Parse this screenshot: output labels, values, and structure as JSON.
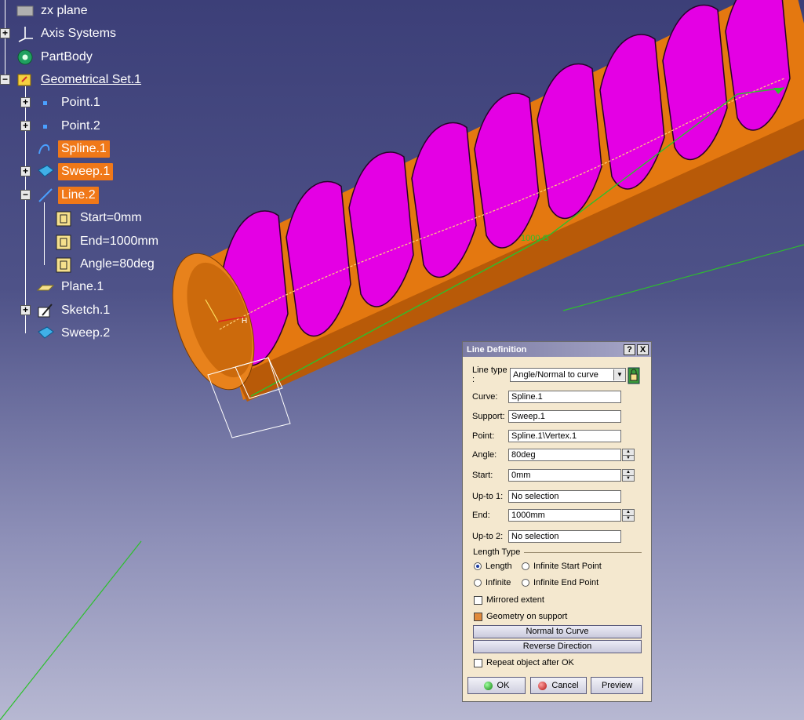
{
  "tree": {
    "zx_plane": "zx plane",
    "axis_systems": "Axis Systems",
    "partbody": "PartBody",
    "geometrical_set": "Geometrical Set.1",
    "point1": "Point.1",
    "point2": "Point.2",
    "spline1": "Spline.1",
    "sweep1": "Sweep.1",
    "line2": "Line.2",
    "start": "Start=0mm",
    "end": "End=1000mm",
    "angle": "Angle=80deg",
    "plane1": "Plane.1",
    "sketch1": "Sketch.1",
    "sweep2": "Sweep.2"
  },
  "viewport": {
    "dimension_label": "1000 G"
  },
  "dialog": {
    "title": "Line Definition",
    "help_button": "?",
    "close_button": "X",
    "line_type_label": "Line type :",
    "line_type_value": "Angle/Normal to curve",
    "curve_label": "Curve:",
    "curve_value": "Spline.1",
    "support_label": "Support:",
    "support_value": "Sweep.1",
    "point_label": "Point:",
    "point_value": "Spline.1\\Vertex.1",
    "angle_label": "Angle:",
    "angle_value": "80deg",
    "start_label": "Start:",
    "start_value": "0mm",
    "upto1_label": "Up-to 1:",
    "upto1_value": "No selection",
    "end_label": "End:",
    "end_value": "1000mm",
    "upto2_label": "Up-to 2:",
    "upto2_value": "No selection",
    "length_type_label": "Length Type",
    "radio_length": "Length",
    "radio_infinite_start": "Infinite Start Point",
    "radio_infinite": "Infinite",
    "radio_infinite_end": "Infinite End Point",
    "mirrored_extent": "Mirrored extent",
    "geometry_on_support": "Geometry on support",
    "normal_to_curve": "Normal to Curve",
    "reverse_direction": "Reverse Direction",
    "repeat_object": "Repeat object after OK",
    "ok": "OK",
    "cancel": "Cancel",
    "preview": "Preview"
  },
  "colors": {
    "background_top": "#3c3f78",
    "background_bottom": "#b7b8d2",
    "tube_orange": "#e47810",
    "thread_magenta": "#e400e4",
    "highlight_orange": "#f07818",
    "dialog_bg": "#f4e8cf",
    "titlebar": "#7c7ca4"
  }
}
